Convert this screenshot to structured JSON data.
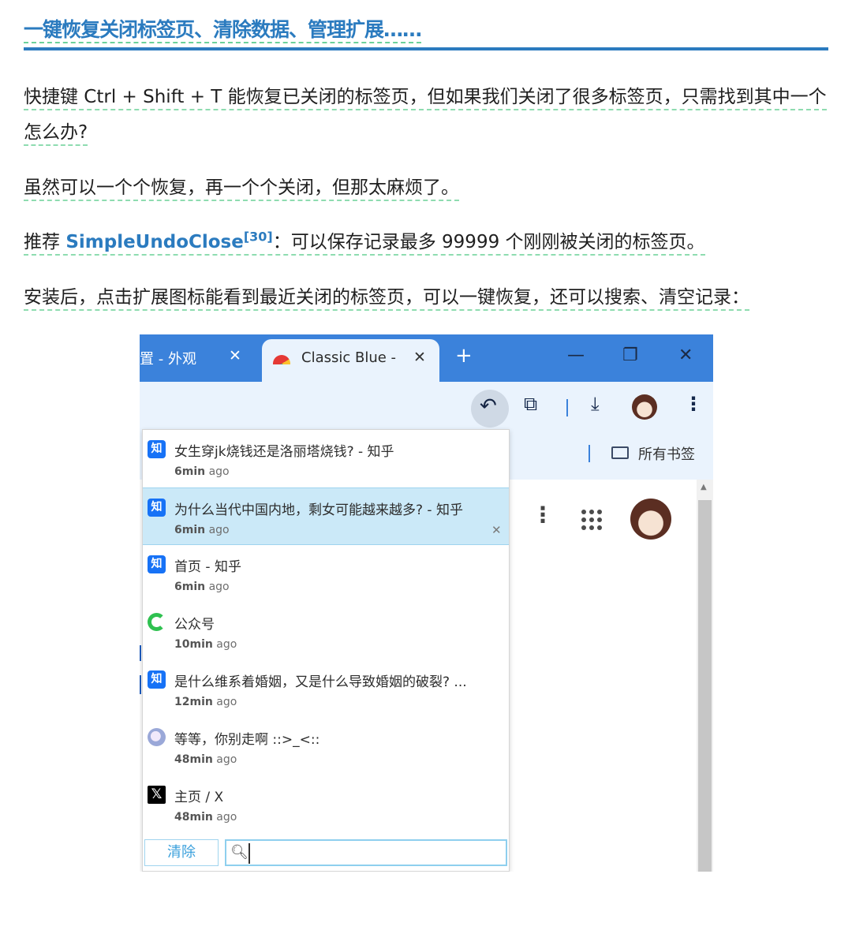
{
  "article": {
    "heading": "一键恢复关闭标签页、清除数据、管理扩展……",
    "p1": "快捷键 Ctrl + Shift + T 能恢复已关闭的标签页，但如果我们关闭了很多标签页，只需找到其中一个怎么办?",
    "p2": "虽然可以一个个恢复，再一个个关闭，但那太麻烦了。",
    "p3_prefix": "推荐 ",
    "p3_link": "SimpleUndoClose",
    "p3_ref": "[30]",
    "p3_suffix": "：可以保存记录最多 99999 个刚刚被关闭的标签页。",
    "p4": "安装后，点击扩展图标能看到最近关闭的标签页，可以一键恢复，还可以搜索、清空记录："
  },
  "browser": {
    "tab_left_title": "置 - 外观",
    "tab_close": "✕",
    "tab_active_title": "Classic Blue -",
    "newtab": "+",
    "win_min": "—",
    "win_restore": "❐",
    "win_close": "✕",
    "bookmarks_label": "所有书签",
    "colors": {
      "frame": "#3b82db",
      "toolbar": "#eaf3fd",
      "highlight": "#cbe9f8"
    }
  },
  "popup": {
    "items": [
      {
        "icon": "zhihu-icon",
        "title": "女生穿jk烧钱还是洛丽塔烧钱? - 知乎",
        "num": "6min",
        "unit": "ago"
      },
      {
        "icon": "zhihu-icon",
        "title": "为什么当代中国内地，剩女可能越来越多? - 知乎",
        "num": "6min",
        "unit": "ago"
      },
      {
        "icon": "zhihu-icon",
        "title": "首页 - 知乎",
        "num": "6min",
        "unit": "ago"
      },
      {
        "icon": "wechat-icon",
        "title": "公众号",
        "num": "10min",
        "unit": "ago"
      },
      {
        "icon": "zhihu-icon",
        "title": "是什么维系着婚姻，又是什么导致婚姻的破裂? ...",
        "num": "12min",
        "unit": "ago"
      },
      {
        "icon": "anime-icon",
        "title": "等等，你别走啊 ::>_<::",
        "num": "48min",
        "unit": "ago"
      },
      {
        "icon": "x-icon",
        "title": "主页 / X",
        "num": "48min",
        "unit": "ago"
      }
    ],
    "zhihu_glyph": "知",
    "x_glyph": "𝕏",
    "clear_label": "清除",
    "search_value": ""
  }
}
